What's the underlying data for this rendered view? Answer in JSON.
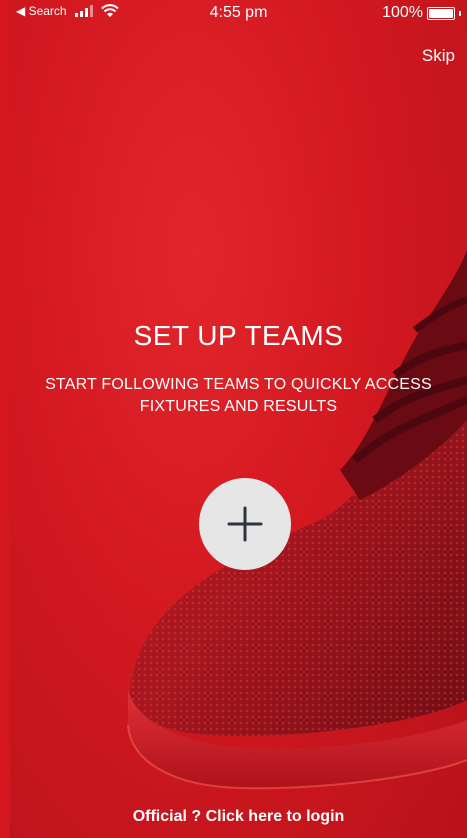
{
  "status_bar": {
    "back_label": "◀ Search",
    "time": "4:55 pm",
    "battery_text": "100%"
  },
  "skip_label": "Skip",
  "title": "SET UP TEAMS",
  "subtitle": "START FOLLOWING TEAMS TO QUICKLY ACCESS FIXTURES AND RESULTS",
  "add_button": {
    "icon": "plus-icon"
  },
  "login_link": "Official ? Click here to login",
  "colors": {
    "background": "#d4161e",
    "shoe": "#7a0d16",
    "button": "#e6e6e6",
    "plus": "#2b3440"
  }
}
